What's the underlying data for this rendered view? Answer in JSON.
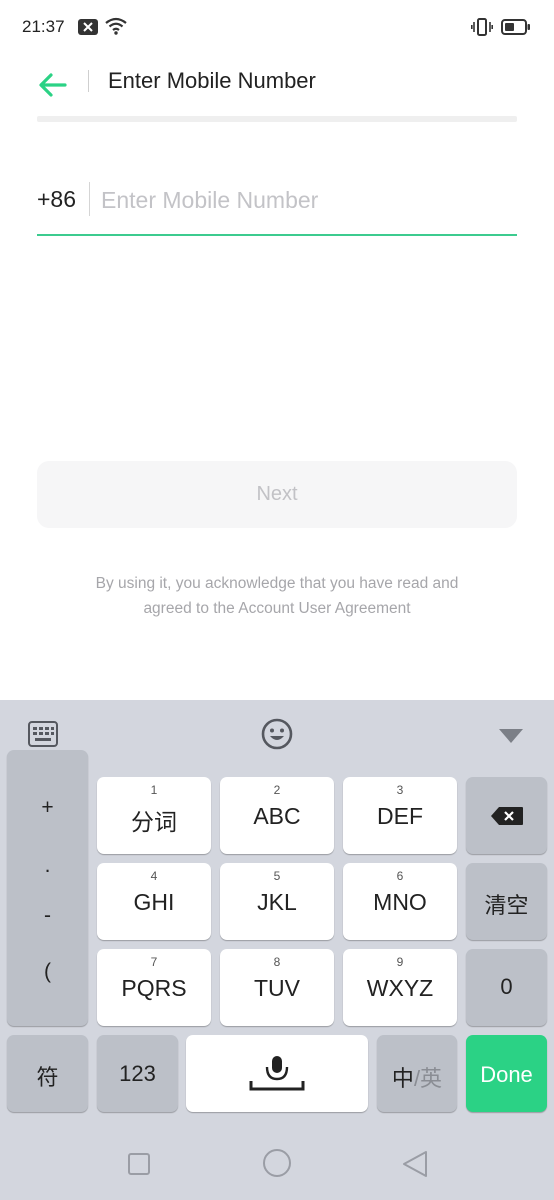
{
  "status_bar": {
    "time": "21:37",
    "icons": [
      "notification-x-icon",
      "wifi-icon",
      "vibrate-icon",
      "battery-icon"
    ]
  },
  "header": {
    "back_icon": "arrow-left-icon",
    "title": "Enter Mobile Number"
  },
  "form": {
    "country_code": "+86",
    "phone_placeholder": "Enter Mobile Number",
    "phone_value": "",
    "next_label": "Next",
    "agreement_line1": "By using it, you acknowledge that you have read and",
    "agreement_line2": "agreed to the Account User Agreement"
  },
  "keyboard": {
    "toolbar_icons": [
      "keyboard-grid-icon",
      "emoji-icon",
      "collapse-icon"
    ],
    "symbols": [
      "+",
      ".",
      "-",
      "("
    ],
    "keys": [
      {
        "num": "1",
        "label": "分词"
      },
      {
        "num": "2",
        "label": "ABC"
      },
      {
        "num": "3",
        "label": "DEF"
      },
      {
        "num": "4",
        "label": "GHI"
      },
      {
        "num": "5",
        "label": "JKL"
      },
      {
        "num": "6",
        "label": "MNO"
      },
      {
        "num": "7",
        "label": "PQRS"
      },
      {
        "num": "8",
        "label": "TUV"
      },
      {
        "num": "9",
        "label": "WXYZ"
      }
    ],
    "clear_label": "清空",
    "zero_label": "0",
    "fu_label": "符",
    "num_label": "123",
    "lang_main": "中",
    "lang_sep": "/英",
    "done_label": "Done"
  },
  "colors": {
    "accent": "#2bd285",
    "underline": "#3ccb8f",
    "keyboard_bg": "#d3d6de"
  }
}
